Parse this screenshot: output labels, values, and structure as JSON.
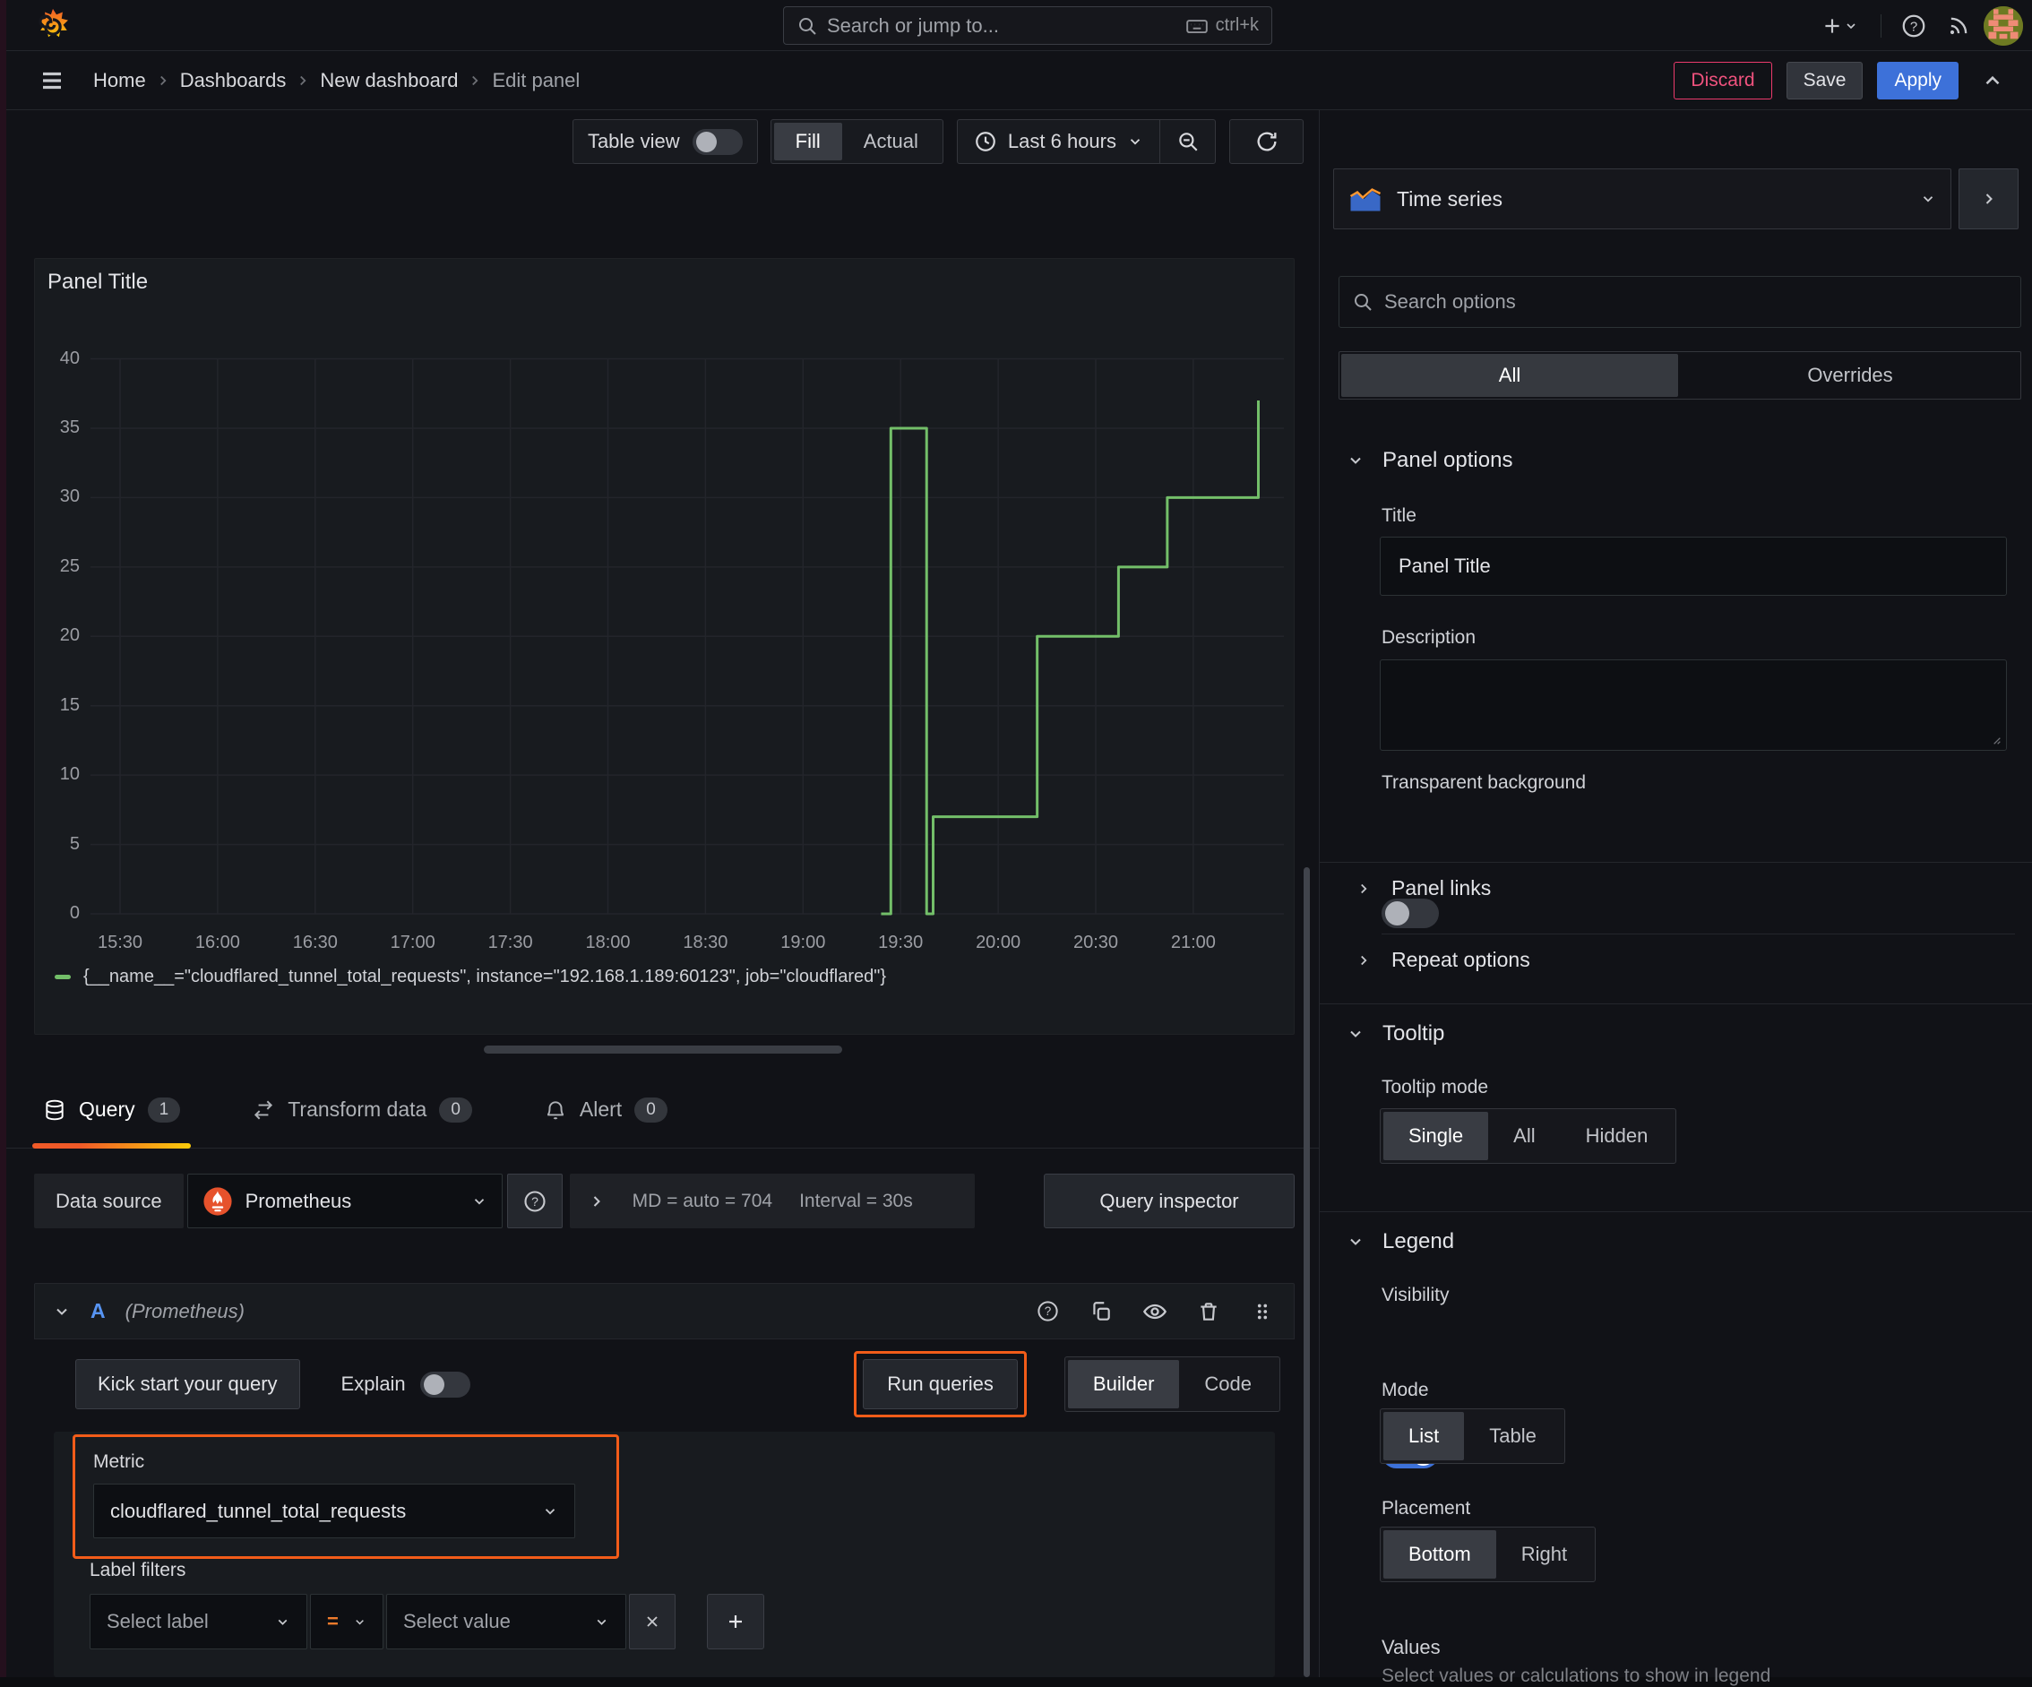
{
  "colors": {
    "accent_orange": "#ff780a",
    "annotation_orange": "#f25c19",
    "series_green": "#73bf69",
    "primary_blue": "#3d71d9",
    "discard_red": "#eb3a6c",
    "refid_blue": "#5794f2",
    "grid": "#23252b"
  },
  "topbar": {
    "search_placeholder": "Search or jump to...",
    "search_shortcut": "ctrl+k"
  },
  "nav": {
    "breadcrumbs": [
      "Home",
      "Dashboards",
      "New dashboard",
      "Edit panel"
    ],
    "discard_label": "Discard",
    "save_label": "Save",
    "apply_label": "Apply"
  },
  "toolbar": {
    "table_view_label": "Table view",
    "fill_label": "Fill",
    "actual_label": "Actual",
    "time_range_label": "Last 6 hours"
  },
  "panel": {
    "title": "Panel Title"
  },
  "chart_data": {
    "type": "line",
    "line_style": "step",
    "title": "Panel Title",
    "xlabel": "",
    "ylabel": "",
    "x_ticks": [
      "15:30",
      "16:00",
      "16:30",
      "17:00",
      "17:30",
      "18:00",
      "18:30",
      "19:00",
      "19:30",
      "20:00",
      "20:30",
      "21:00"
    ],
    "y_ticks": [
      0,
      5,
      10,
      15,
      20,
      25,
      30,
      35,
      40
    ],
    "ylim": [
      0,
      40
    ],
    "grid": true,
    "legend_position": "bottom",
    "series": [
      {
        "name": "{__name__=\"cloudflared_tunnel_total_requests\", instance=\"192.168.1.189:60123\", job=\"cloudflared\"}",
        "color": "#73bf69",
        "points": [
          [
            "19:24",
            0
          ],
          [
            "19:27",
            0
          ],
          [
            "19:27",
            35
          ],
          [
            "19:38",
            35
          ],
          [
            "19:38",
            0
          ],
          [
            "19:40",
            0
          ],
          [
            "19:40",
            7
          ],
          [
            "20:12",
            7
          ],
          [
            "20:12",
            20
          ],
          [
            "20:37",
            20
          ],
          [
            "20:37",
            25
          ],
          [
            "20:52",
            25
          ],
          [
            "20:52",
            30
          ],
          [
            "21:20",
            30
          ],
          [
            "21:20",
            37
          ]
        ]
      }
    ]
  },
  "tabs": {
    "query_label": "Query",
    "query_count": "1",
    "transform_label": "Transform data",
    "transform_count": "0",
    "alert_label": "Alert",
    "alert_count": "0"
  },
  "datasource": {
    "label": "Data source",
    "name": "Prometheus",
    "stats_md": "MD = auto = 704",
    "stats_interval": "Interval = 30s",
    "inspector_label": "Query inspector"
  },
  "query": {
    "ref_id": "A",
    "ds_hint": "(Prometheus)",
    "kickstart_label": "Kick start your query",
    "explain_label": "Explain",
    "run_label": "Run queries",
    "builder_label": "Builder",
    "code_label": "Code",
    "metric_label": "Metric",
    "metric_value": "cloudflared_tunnel_total_requests",
    "label_filters_label": "Label filters",
    "select_label_placeholder": "Select label",
    "operator": "=",
    "select_value_placeholder": "Select value"
  },
  "sidebar": {
    "viz_name": "Time series",
    "search_placeholder": "Search options",
    "tab_all": "All",
    "tab_overrides": "Overrides",
    "panel_options": {
      "heading": "Panel options",
      "title_label": "Title",
      "title_value": "Panel Title",
      "description_label": "Description",
      "transparent_label": "Transparent background"
    },
    "links_heading": "Panel links",
    "repeat_heading": "Repeat options",
    "tooltip": {
      "heading": "Tooltip",
      "mode_label": "Tooltip mode",
      "options": [
        "Single",
        "All",
        "Hidden"
      ]
    },
    "legend": {
      "heading": "Legend",
      "visibility_label": "Visibility",
      "mode_label": "Mode",
      "modes": [
        "List",
        "Table"
      ],
      "placement_label": "Placement",
      "placements": [
        "Bottom",
        "Right"
      ],
      "values_label": "Values",
      "values_help": "Select values or calculations to show in legend"
    }
  }
}
